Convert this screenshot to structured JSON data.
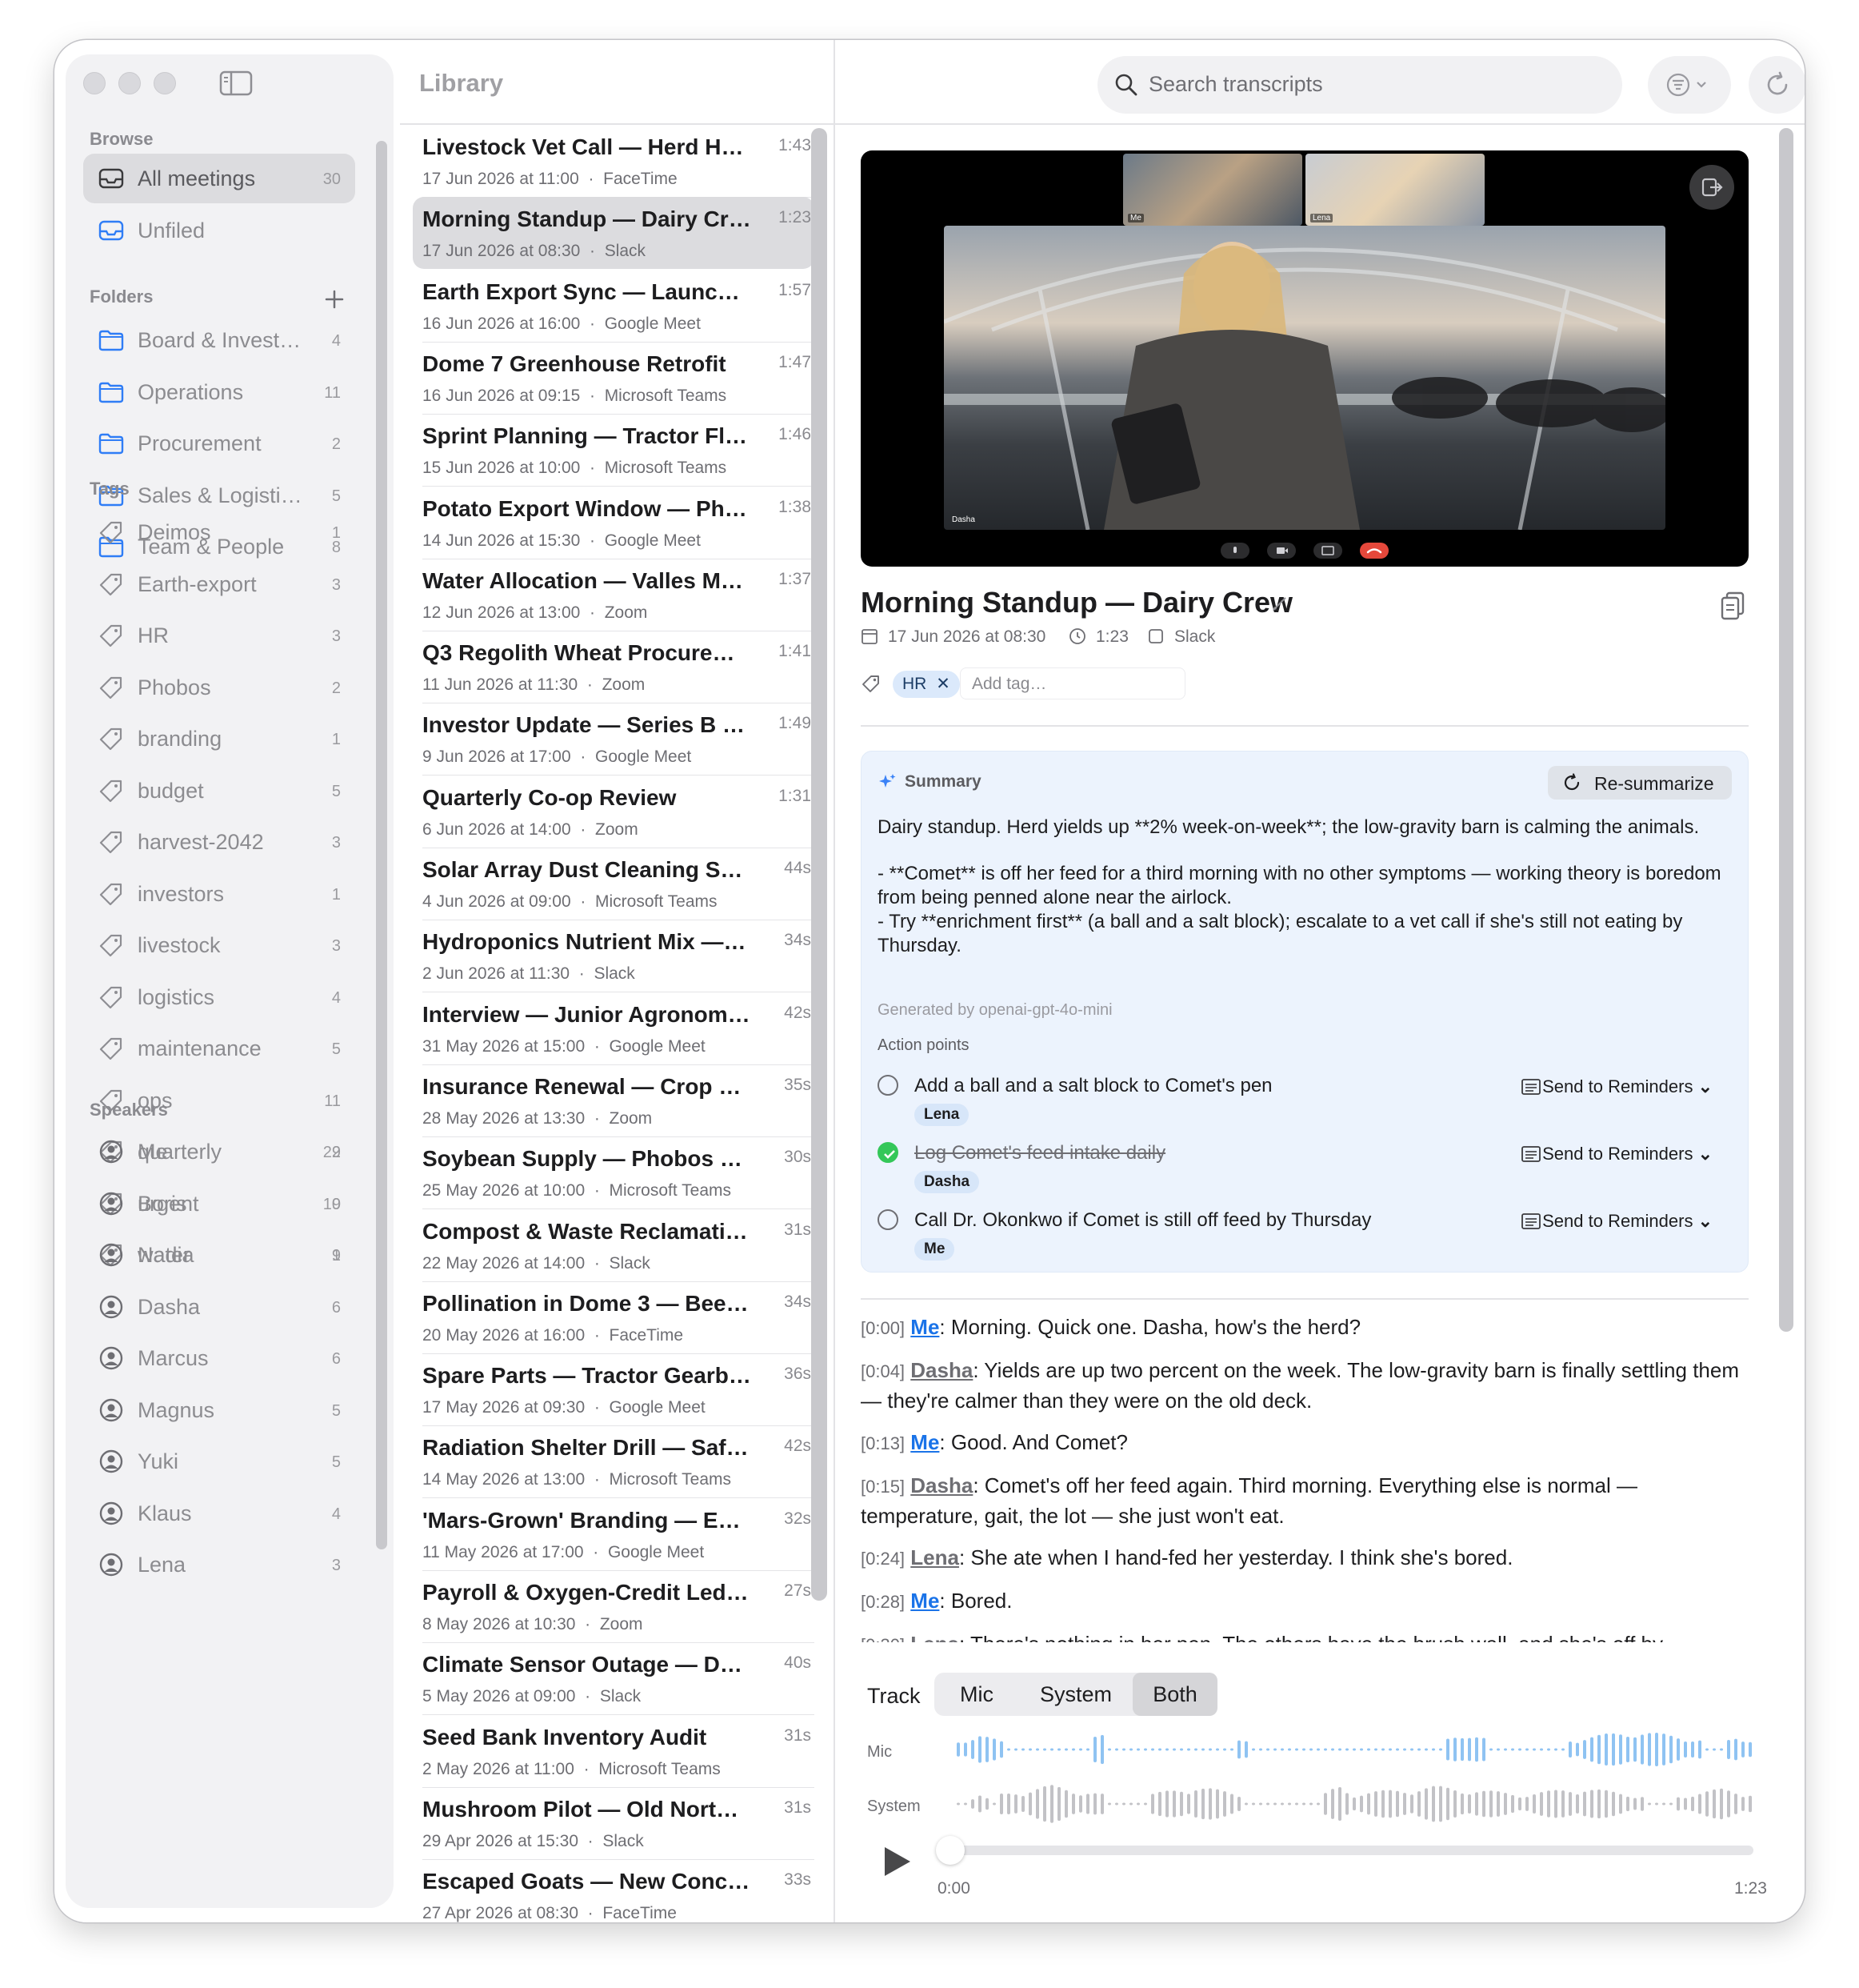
{
  "sidebar": {
    "browse_label": "Browse",
    "browse": [
      {
        "label": "All meetings",
        "count": "30",
        "icon": "tray-icon"
      },
      {
        "label": "Unfiled",
        "count": "",
        "icon": "tray-icon"
      }
    ],
    "folders_label": "Folders",
    "folders": [
      {
        "label": "Board & Invest…",
        "count": "4"
      },
      {
        "label": "Operations",
        "count": "11"
      },
      {
        "label": "Procurement",
        "count": "2"
      },
      {
        "label": "Sales & Logisti…",
        "count": "5"
      },
      {
        "label": "Team & People",
        "count": "8"
      }
    ],
    "tags_label": "Tags",
    "tags": [
      {
        "label": "Deimos",
        "count": "1"
      },
      {
        "label": "Earth-export",
        "count": "3"
      },
      {
        "label": "HR",
        "count": "3"
      },
      {
        "label": "Phobos",
        "count": "2"
      },
      {
        "label": "branding",
        "count": "1"
      },
      {
        "label": "budget",
        "count": "5"
      },
      {
        "label": "harvest-2042",
        "count": "3"
      },
      {
        "label": "investors",
        "count": "1"
      },
      {
        "label": "livestock",
        "count": "3"
      },
      {
        "label": "logistics",
        "count": "4"
      },
      {
        "label": "maintenance",
        "count": "5"
      },
      {
        "label": "ops",
        "count": "11"
      },
      {
        "label": "quarterly",
        "count": "2"
      },
      {
        "label": "urgent",
        "count": "9"
      },
      {
        "label": "water",
        "count": "1"
      }
    ],
    "speakers_label": "Speakers",
    "speakers": [
      {
        "label": "Me",
        "count": "29"
      },
      {
        "label": "Boris",
        "count": "10"
      },
      {
        "label": "Nadia",
        "count": "9"
      },
      {
        "label": "Dasha",
        "count": "6"
      },
      {
        "label": "Marcus",
        "count": "6"
      },
      {
        "label": "Magnus",
        "count": "5"
      },
      {
        "label": "Yuki",
        "count": "5"
      },
      {
        "label": "Klaus",
        "count": "4"
      },
      {
        "label": "Lena",
        "count": "3"
      }
    ]
  },
  "library": {
    "title": "Library",
    "meetings": [
      {
        "title": "Livestock Vet Call — Herd He…",
        "date": "17 Jun 2026 at 11:00",
        "app": "FaceTime",
        "duration": "1:43"
      },
      {
        "title": "Morning Standup — Dairy Crew",
        "date": "17 Jun 2026 at 08:30",
        "app": "Slack",
        "duration": "1:23",
        "selected": true
      },
      {
        "title": "Earth Export Sync — Launch…",
        "date": "16 Jun 2026 at 16:00",
        "app": "Google Meet",
        "duration": "1:57"
      },
      {
        "title": "Dome 7 Greenhouse Retrofit",
        "date": "16 Jun 2026 at 09:15",
        "app": "Microsoft Teams",
        "duration": "1:47"
      },
      {
        "title": "Sprint Planning — Tractor Fleet",
        "date": "15 Jun 2026 at 10:00",
        "app": "Microsoft Teams",
        "duration": "1:46"
      },
      {
        "title": "Potato Export Window — Pho…",
        "date": "14 Jun 2026 at 15:30",
        "app": "Google Meet",
        "duration": "1:38"
      },
      {
        "title": "Water Allocation — Valles Ma…",
        "date": "12 Jun 2026 at 13:00",
        "app": "Zoom",
        "duration": "1:37"
      },
      {
        "title": "Q3 Regolith Wheat Procurem…",
        "date": "11 Jun 2026 at 11:30",
        "app": "Zoom",
        "duration": "1:41"
      },
      {
        "title": "Investor Update — Series B (…",
        "date": "9 Jun 2026 at 17:00",
        "app": "Google Meet",
        "duration": "1:49"
      },
      {
        "title": "Quarterly Co-op Review",
        "date": "6 Jun 2026 at 14:00",
        "app": "Zoom",
        "duration": "1:31"
      },
      {
        "title": "Solar Array Dust Cleaning Sc…",
        "date": "4 Jun 2026 at 09:00",
        "app": "Microsoft Teams",
        "duration": "44s"
      },
      {
        "title": "Hydroponics Nutrient Mix — L…",
        "date": "2 Jun 2026 at 11:30",
        "app": "Slack",
        "duration": "34s"
      },
      {
        "title": "Interview — Junior Agronomist",
        "date": "31 May 2026 at 15:00",
        "app": "Google Meet",
        "duration": "42s"
      },
      {
        "title": "Insurance Renewal — Crop &…",
        "date": "28 May 2026 at 13:30",
        "app": "Zoom",
        "duration": "35s"
      },
      {
        "title": "Soybean Supply — Phobos Ca…",
        "date": "25 May 2026 at 10:00",
        "app": "Microsoft Teams",
        "duration": "30s"
      },
      {
        "title": "Compost & Waste Reclamatio…",
        "date": "22 May 2026 at 14:00",
        "app": "Slack",
        "duration": "31s"
      },
      {
        "title": "Pollination in Dome 3 — Bees…",
        "date": "20 May 2026 at 16:00",
        "app": "FaceTime",
        "duration": "34s"
      },
      {
        "title": "Spare Parts — Tractor Gearbo…",
        "date": "17 May 2026 at 09:30",
        "app": "Google Meet",
        "duration": "36s"
      },
      {
        "title": "Radiation Shelter Drill — Safe…",
        "date": "14 May 2026 at 13:00",
        "app": "Microsoft Teams",
        "duration": "42s"
      },
      {
        "title": "'Mars-Grown' Branding — Ear…",
        "date": "11 May 2026 at 17:00",
        "app": "Google Meet",
        "duration": "32s"
      },
      {
        "title": "Payroll & Oxygen-Credit Ledg…",
        "date": "8 May 2026 at 10:30",
        "app": "Zoom",
        "duration": "27s"
      },
      {
        "title": "Climate Sensor Outage — Do…",
        "date": "5 May 2026 at 09:00",
        "app": "Slack",
        "duration": "40s"
      },
      {
        "title": "Seed Bank Inventory Audit",
        "date": "2 May 2026 at 11:00",
        "app": "Microsoft Teams",
        "duration": "31s"
      },
      {
        "title": "Mushroom Pilot — Old North…",
        "date": "29 Apr 2026 at 15:30",
        "app": "Slack",
        "duration": "31s"
      },
      {
        "title": "Escaped Goats — New Conco…",
        "date": "27 Apr 2026 at 08:30",
        "app": "FaceTime",
        "duration": "33s"
      }
    ]
  },
  "toolbar": {
    "search_placeholder": "Search transcripts"
  },
  "video": {
    "thumb_labels": [
      "Me",
      "Lena"
    ],
    "main_label": "Dasha"
  },
  "detail": {
    "title": "Morning Standup — Dairy Crew",
    "date": "17 Jun 2026 at 08:30",
    "duration": "1:23",
    "app": "Slack",
    "tags": [
      "HR"
    ],
    "add_tag_placeholder": "Add tag…"
  },
  "summary": {
    "heading": "Summary",
    "resummarize_label": "Re-summarize",
    "paragraph_1": "Dairy standup. Herd yields up **2% week-on-week**; the low-gravity barn is calming the animals.",
    "bullet_1": "- **Comet** is off her feed for a third morning with no other symptoms — working theory is boredom from being penned alone near the airlock.",
    "bullet_2": "- Try **enrichment first** (a ball and a salt block); escalate to a vet call if she's still not eating by Thursday.",
    "generated_by": "Generated by openai-gpt-4o-mini",
    "action_points_label": "Action points",
    "action_points": [
      {
        "text": "Add a ball and a salt block to Comet's pen",
        "assignee": "Lena",
        "done": false,
        "send_label": "Send to Reminders"
      },
      {
        "text": "Log Comet's feed intake daily",
        "assignee": "Dasha",
        "done": true,
        "send_label": "Send to Reminders"
      },
      {
        "text": "Call Dr. Okonkwo if Comet is still off feed by Thursday",
        "assignee": "Me",
        "done": false,
        "send_label": "Send to Reminders"
      }
    ]
  },
  "transcript": [
    {
      "time": "[0:00]",
      "speaker": "Me",
      "text": ": Morning. Quick one. Dasha, how's the herd?"
    },
    {
      "time": "[0:04]",
      "speaker": "Dasha",
      "text": ": Yields are up two percent on the week. The low-gravity barn is finally settling them — they're calmer than they were on the old deck."
    },
    {
      "time": "[0:13]",
      "speaker": "Me",
      "text": ": Good. And Comet?"
    },
    {
      "time": "[0:15]",
      "speaker": "Dasha",
      "text": ": Comet's off her feed again. Third morning. Everything else is normal — temperature, gait, the lot — she just won't eat."
    },
    {
      "time": "[0:24]",
      "speaker": "Lena",
      "text": ": She ate when I hand-fed her yesterday. I think she's bored."
    },
    {
      "time": "[0:28]",
      "speaker": "Me",
      "text": ": Bored."
    },
    {
      "time": "[0:30]",
      "speaker": "Lena",
      "text": ": There's nothing in her pen. The others have the brush wall, and she's off by"
    }
  ],
  "player": {
    "track_label": "Track",
    "track_options": [
      "Mic",
      "System",
      "Both"
    ],
    "track_selected": "Both",
    "mic_label": "Mic",
    "system_label": "System",
    "current_time": "0:00",
    "total_time": "1:23",
    "progress": 0.0
  }
}
